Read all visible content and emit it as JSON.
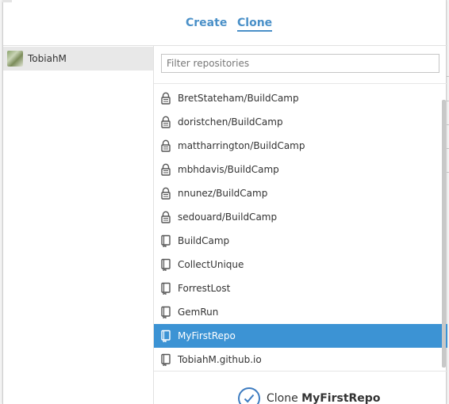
{
  "tabs": {
    "create": "Create",
    "clone": "Clone"
  },
  "account": {
    "name": "TobiahM"
  },
  "filter": {
    "placeholder": "Filter repositories",
    "value": ""
  },
  "repos": [
    {
      "name": "BretStateham/BuildCamp",
      "icon": "lock-icon"
    },
    {
      "name": "doristchen/BuildCamp",
      "icon": "lock-icon"
    },
    {
      "name": "mattharrington/BuildCamp",
      "icon": "lock-icon"
    },
    {
      "name": "mbhdavis/BuildCamp",
      "icon": "lock-icon"
    },
    {
      "name": "nnunez/BuildCamp",
      "icon": "lock-icon"
    },
    {
      "name": "sedouard/BuildCamp",
      "icon": "lock-icon"
    },
    {
      "name": "BuildCamp",
      "icon": "repo-icon"
    },
    {
      "name": "CollectUnique",
      "icon": "repo-icon"
    },
    {
      "name": "ForrestLost",
      "icon": "repo-icon"
    },
    {
      "name": "GemRun",
      "icon": "repo-icon"
    },
    {
      "name": "MyFirstRepo",
      "icon": "repo-icon"
    },
    {
      "name": "TobiahM.github.io",
      "icon": "repo-icon"
    }
  ],
  "selected_repo": "MyFirstRepo",
  "clone_button": {
    "prefix": "Clone",
    "repo": "MyFirstRepo"
  },
  "colors": {
    "accent": "#4a90c8",
    "selected": "#3c93d4"
  }
}
